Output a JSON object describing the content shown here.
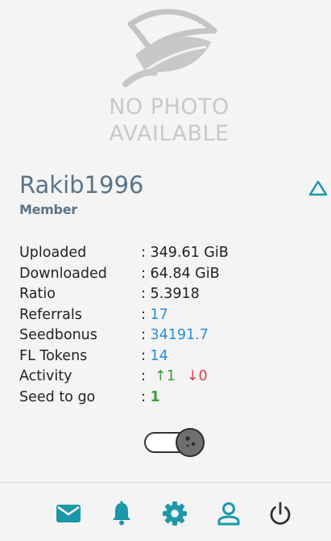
{
  "profile": {
    "photo_placeholder_line1": "NO PHOTO",
    "photo_placeholder_line2": "AVAILABLE",
    "username": "Rakib1996",
    "role": "Member"
  },
  "stats": [
    {
      "label": "Uploaded",
      "sep": ":",
      "value": "349.61 GiB"
    },
    {
      "label": "Downloaded",
      "sep": ":",
      "value": "64.84 GiB"
    },
    {
      "label": "Ratio",
      "sep": ":",
      "value": "5.3918"
    },
    {
      "label": "Referrals",
      "sep": ":",
      "value": "17"
    },
    {
      "label": "Seedbonus",
      "sep": ":",
      "value": "34191.7"
    },
    {
      "label": "FL Tokens",
      "sep": ":",
      "value": "14"
    },
    {
      "label": "Activity",
      "sep": ":",
      "up": "↑1",
      "down": "↓0"
    },
    {
      "label": "Seed to go",
      "sep": ":",
      "value": "1"
    }
  ],
  "toggle": {
    "state": "on"
  },
  "bottom_nav": [
    {
      "name": "messages",
      "icon": "mail-icon"
    },
    {
      "name": "notifications",
      "icon": "bell-icon"
    },
    {
      "name": "settings",
      "icon": "gear-icon"
    },
    {
      "name": "profile",
      "icon": "user-icon"
    },
    {
      "name": "logout",
      "icon": "power-icon"
    }
  ],
  "colors": {
    "accent": "#1a98a8",
    "link": "#2a8fd6",
    "username": "#5b7487",
    "up": "#3a9d3a",
    "down": "#e0404a"
  }
}
